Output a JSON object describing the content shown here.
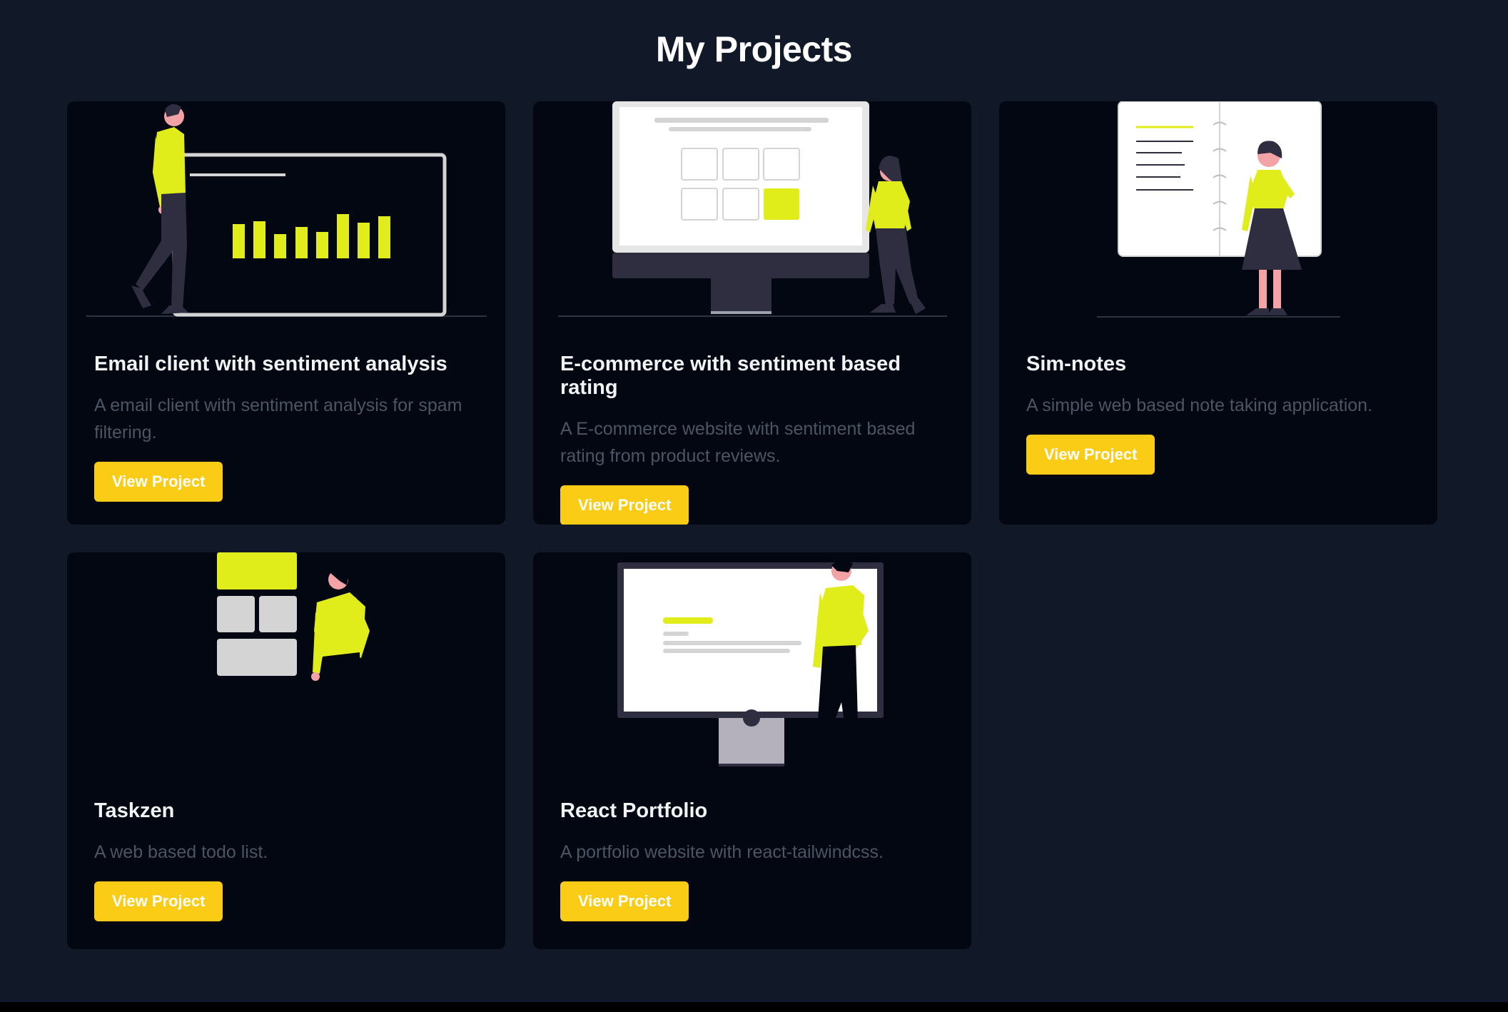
{
  "section": {
    "title": "My Projects"
  },
  "colors": {
    "background": "#111827",
    "card": "#030712",
    "accent": "#facc15",
    "illustration_accent": "#e1ec1b"
  },
  "projects": [
    {
      "title": "Email client with sentiment analysis",
      "description": "A email client with sentiment analysis for spam filtering.",
      "button_label": "View Project",
      "illustration": "man-presenting-bar-chart"
    },
    {
      "title": "E-commerce with sentiment based rating",
      "description": "A E-commerce website with sentiment based rating from product reviews.",
      "button_label": "View Project",
      "illustration": "woman-beside-desktop-monitor"
    },
    {
      "title": "Sim-notes",
      "description": "A simple web based note taking application.",
      "button_label": "View Project",
      "illustration": "woman-with-notebook"
    },
    {
      "title": "Taskzen",
      "description": "A web based todo list.",
      "button_label": "View Project",
      "illustration": "man-with-task-blocks"
    },
    {
      "title": "React Portfolio",
      "description": "A portfolio website with react-tailwindcss.",
      "button_label": "View Project",
      "illustration": "man-at-screen"
    }
  ]
}
